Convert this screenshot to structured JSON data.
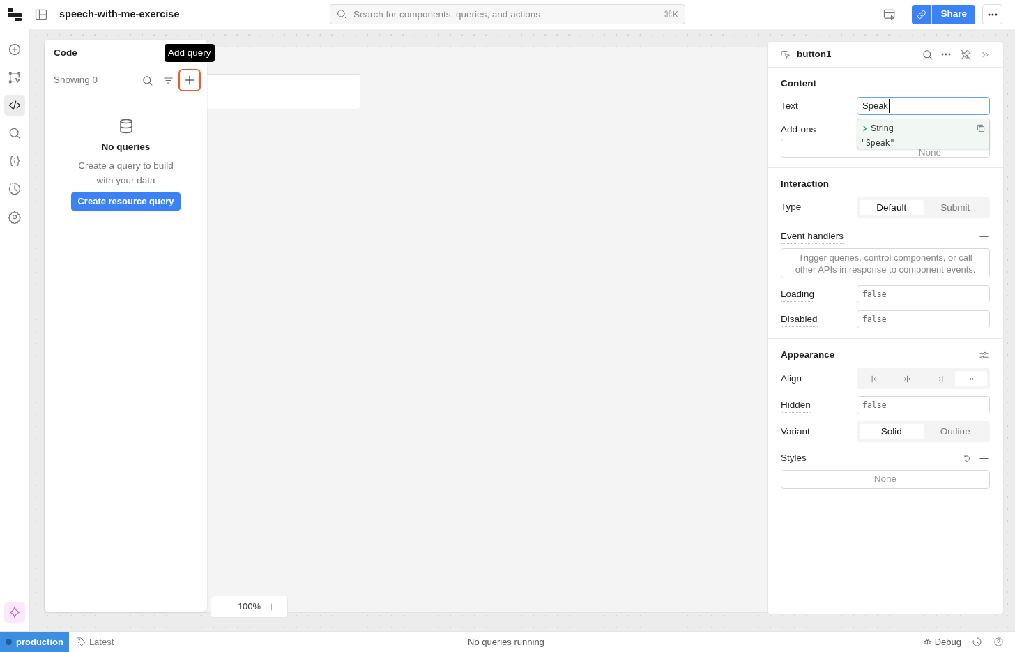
{
  "app": {
    "title": "speech-with-me-exercise"
  },
  "search": {
    "placeholder": "Search for components, queries, and actions",
    "shortcut": "⌘K"
  },
  "share": {
    "label": "Share"
  },
  "rail": [
    {
      "kind": "add",
      "selected": false
    },
    {
      "kind": "components",
      "selected": false
    },
    {
      "kind": "code",
      "selected": true
    },
    {
      "kind": "search",
      "selected": false
    },
    {
      "kind": "state",
      "selected": false
    },
    {
      "kind": "history",
      "selected": false
    },
    {
      "kind": "settings",
      "selected": false
    }
  ],
  "code_panel": {
    "title": "Code",
    "count": "Showing 0",
    "tooltip": "Add query",
    "empty_title": "No queries",
    "empty_text": "Create a query to build with your data",
    "button": "Create resource query"
  },
  "zoom": {
    "value": "100%"
  },
  "inspector": {
    "component": "button1",
    "sections": [
      {
        "title": "Content",
        "rows": [
          {
            "kind": "input",
            "label": "Text",
            "value": "Speak",
            "focused": true,
            "autocomplete": {
              "type": "String",
              "value": "\"Speak\""
            }
          },
          {
            "kind": "list",
            "label": "Add-ons",
            "empty": "None"
          }
        ]
      },
      {
        "title": "Interaction",
        "rows": [
          {
            "kind": "segmented",
            "label": "Type",
            "options": [
              {
                "label": "Default",
                "selected": true
              },
              {
                "label": "Submit",
                "selected": false
              }
            ]
          },
          {
            "kind": "handlers",
            "label": "Event handlers",
            "empty": "Trigger queries, control components, or call other APIs in response to component events."
          },
          {
            "kind": "code",
            "label": "Loading",
            "value": "false"
          },
          {
            "kind": "code",
            "label": "Disabled",
            "value": "false"
          }
        ]
      },
      {
        "title": "Appearance",
        "rows": [
          {
            "kind": "align",
            "label": "Align",
            "options": [
              {
                "kind": "left",
                "selected": false
              },
              {
                "kind": "center",
                "selected": false
              },
              {
                "kind": "right",
                "selected": false
              },
              {
                "kind": "stretch",
                "selected": true
              }
            ]
          },
          {
            "kind": "code",
            "label": "Hidden",
            "value": "false"
          },
          {
            "kind": "segmented",
            "label": "Variant",
            "options": [
              {
                "label": "Solid",
                "selected": true
              },
              {
                "label": "Outline",
                "selected": false
              }
            ]
          },
          {
            "kind": "styles",
            "label": "Styles",
            "empty": "None"
          }
        ]
      }
    ]
  },
  "status_bar": {
    "environment": "production",
    "version": "Latest",
    "center": "No queries running",
    "debug": "Debug"
  }
}
